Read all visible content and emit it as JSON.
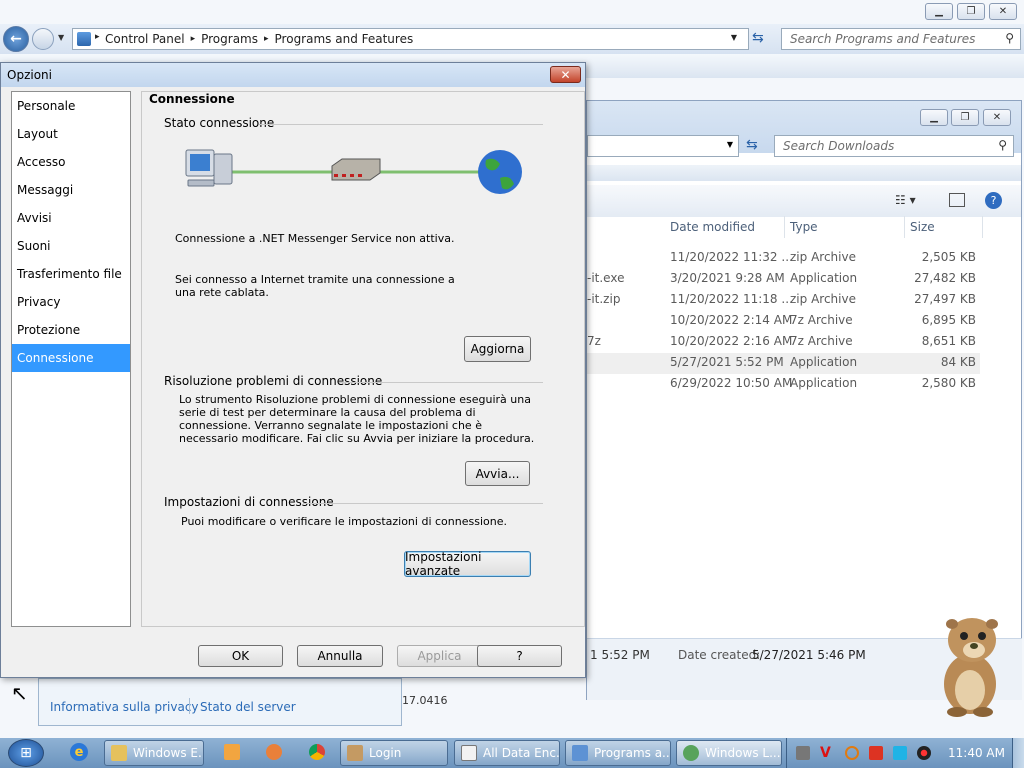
{
  "control_panel": {
    "breadcrumb": [
      "Control Panel",
      "Programs",
      "Programs and Features"
    ],
    "search_placeholder": "Search Programs and Features"
  },
  "downloads": {
    "search_placeholder": "Search Downloads",
    "columns": [
      "Date modified",
      "Type",
      "Size"
    ],
    "rows": [
      {
        "name": "",
        "date": "11/20/2022 11:32 ...",
        "type": "zip Archive",
        "size": "2,505 KB"
      },
      {
        "name": "-it.exe",
        "date": "3/20/2021 9:28 AM",
        "type": "Application",
        "size": "27,482 KB"
      },
      {
        "name": "-it.zip",
        "date": "11/20/2022 11:18 ...",
        "type": "zip Archive",
        "size": "27,497 KB"
      },
      {
        "name": "",
        "date": "10/20/2022 2:14 AM",
        "type": "7z Archive",
        "size": "6,895 KB"
      },
      {
        "name": "7z",
        "date": "10/20/2022 2:16 AM",
        "type": "7z Archive",
        "size": "8,651 KB"
      },
      {
        "name": "",
        "date": "5/27/2021 5:52 PM",
        "type": "Application",
        "size": "84 KB"
      },
      {
        "name": "",
        "date": "6/29/2022 10:50 AM",
        "type": "Application",
        "size": "2,580 KB"
      }
    ],
    "details_modified": "1 5:52 PM",
    "details_created_label": "Date created:",
    "details_created_value": "5/27/2021 5:46 PM"
  },
  "options_dialog": {
    "title": "Opzioni",
    "categories": [
      "Personale",
      "Layout",
      "Accesso",
      "Messaggi",
      "Avvisi",
      "Suoni",
      "Trasferimento file",
      "Privacy",
      "Protezione",
      "Connessione"
    ],
    "selected_category": "Connessione",
    "heading": "Connessione",
    "status_section": "Stato connessione",
    "status_text": "Connessione a .NET Messenger Service non attiva.",
    "internet_text": "Sei connesso a Internet tramite una connessione a una rete cablata.",
    "refresh_button": "Aggiorna",
    "troubleshoot_section": "Risoluzione problemi di connessione",
    "troubleshoot_text": "Lo strumento Risoluzione problemi di connessione eseguirà una serie di test per determinare la causa del problema di connessione. Verranno segnalate le impostazioni che è necessario modificare. Fai clic su Avvia per iniziare la procedura.",
    "start_button": "Avvia...",
    "settings_section": "Impostazioni di connessione",
    "settings_text": "Puoi modificare o verificare le impostazioni di connessione.",
    "advanced_button": "Impostazioni avanzate",
    "ok_button": "OK",
    "cancel_button": "Annulla",
    "apply_button": "Applica",
    "help_button": "?"
  },
  "privacy_bar": {
    "privacy_link": "Informativa sulla privacy",
    "server_link": "Stato del server",
    "version_fragment": "17.0416"
  },
  "taskbar": {
    "tasks": [
      "Windows E...",
      "Login",
      "All Data Enc...",
      "Programs a...",
      "Windows L..."
    ],
    "clock": "11:40 AM"
  }
}
